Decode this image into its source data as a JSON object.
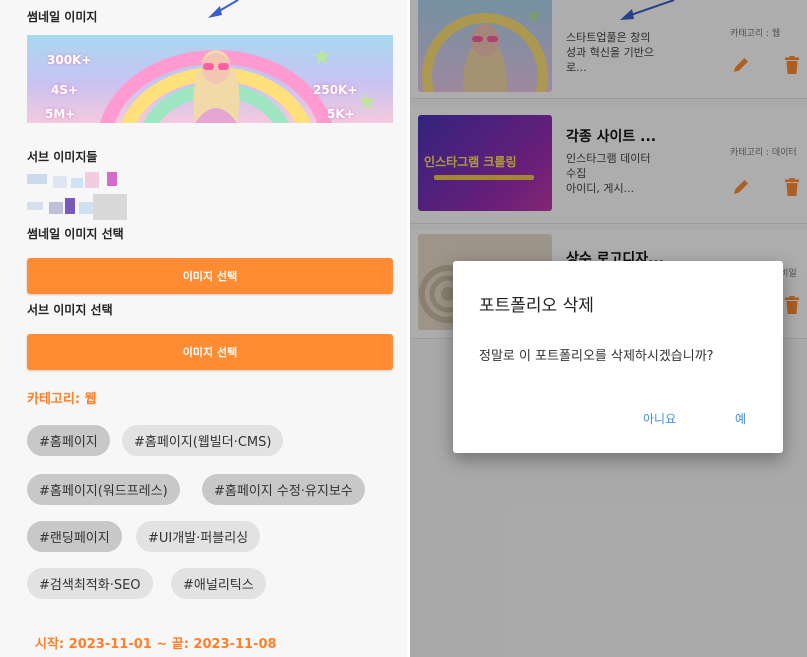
{
  "left": {
    "thumbnail_label": "썸네일 이미지",
    "thumbnail_stats": [
      "300K+",
      "4S+",
      "250K+",
      "5M+",
      "5K+"
    ],
    "sub_images_label": "서브 이미지들",
    "select_thumbnail_label": "썸네일 이미지 선택",
    "select_thumbnail_button": "이미지 선택",
    "select_sub_label": "서브 이미지 선택",
    "select_sub_button": "이미지 선택",
    "category": "카테고리: 웹",
    "tags": [
      {
        "label": "#홈페이지",
        "selected": true
      },
      {
        "label": "#홈페이지(웹빌더·CMS)",
        "selected": false
      },
      {
        "label": "#홈페이지(워드프레스)",
        "selected": true
      },
      {
        "label": "#홈페이지 수정·유지보수",
        "selected": true
      },
      {
        "label": "#랜딩페이지",
        "selected": true
      },
      {
        "label": "#UI개발·퍼블리싱",
        "selected": false
      },
      {
        "label": "#검색최적화·SEO",
        "selected": false
      },
      {
        "label": "#애널리틱스",
        "selected": false
      }
    ],
    "dates": "시작: 2023-11-01 ~ 끝: 2023-11-08"
  },
  "right": {
    "cards": [
      {
        "title": "",
        "desc_lines": [
          "스타트업풀은 창의",
          "성과 혁신을 기반으",
          "로..."
        ],
        "category": "카테고리 : 웹"
      },
      {
        "title": "각종 사이트 ...",
        "desc_lines": [
          "인스타그램 데이터",
          "수집",
          "아이디, 게시..."
        ],
        "category": "카테고리 : 데이터",
        "image_text": "인스타그램 크롤링"
      },
      {
        "title": "상수 로고디자...",
        "desc_lines": [],
        "category": "카테고리 : 웹비일"
      }
    ],
    "dialog": {
      "title": "포트폴리오 삭제",
      "message": "정말로 이 포트폴리오를 삭제하시겠습니까?",
      "no_label": "아니요",
      "yes_label": "예"
    }
  },
  "colors": {
    "accent": "#ff8c33",
    "accent_text": "#ff7f2a",
    "dialog_button": "#3f8fd8",
    "arrow": "#3b5fc9"
  }
}
